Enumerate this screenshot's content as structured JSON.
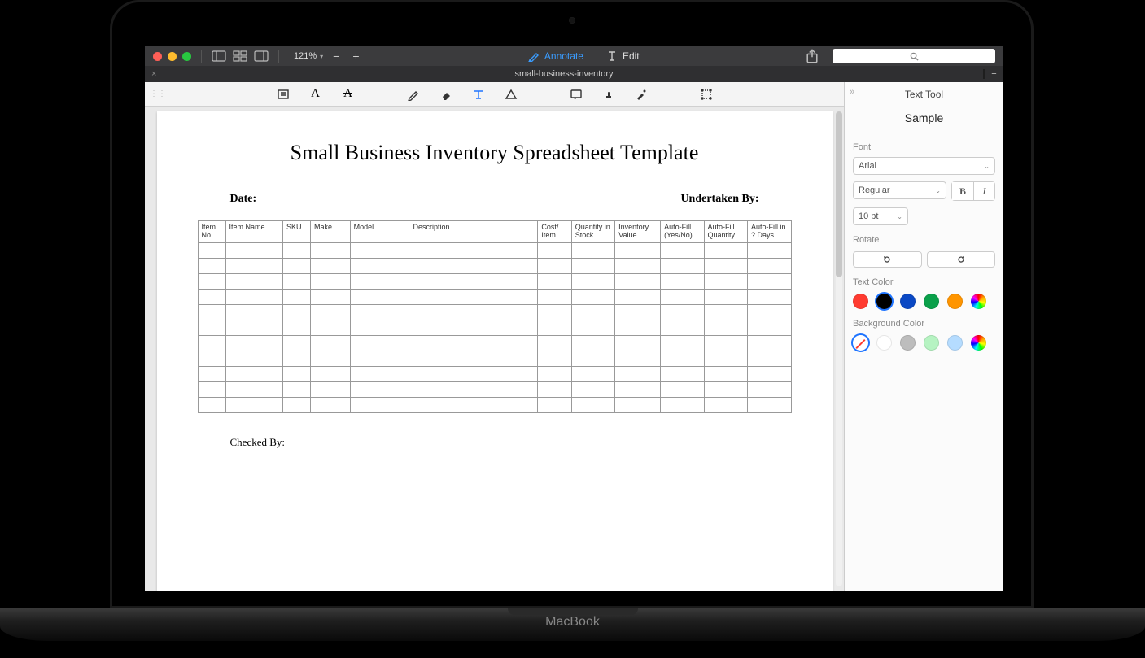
{
  "device": {
    "label": "MacBook"
  },
  "titlebar": {
    "zoom": "121%",
    "annotate": "Annotate",
    "edit": "Edit"
  },
  "tab": {
    "title": "small-business-inventory"
  },
  "document": {
    "title": "Small Business Inventory Spreadsheet Template",
    "date_label": "Date:",
    "undertaken_label": "Undertaken By:",
    "checked_label": "Checked By:",
    "columns": [
      "Item No.",
      "Item Name",
      "SKU",
      "Make",
      "Model",
      "Description",
      "Cost/ Item",
      "Quantity in Stock",
      "Inventory Value",
      "Auto-Fill (Yes/No)",
      "Auto-Fill Quantity",
      "Auto-Fill in ? Days"
    ],
    "empty_rows": 11
  },
  "sidebar": {
    "title": "Text Tool",
    "sample": "Sample",
    "labels": {
      "font": "Font",
      "rotate": "Rotate",
      "text_color": "Text Color",
      "bg_color": "Background Color"
    },
    "font_family": "Arial",
    "font_weight": "Regular",
    "font_size": "10 pt",
    "bold": "B",
    "italic": "I",
    "text_colors": [
      "#ff3b30",
      "#000000",
      "#0a48c4",
      "#0aa04a",
      "#ff9500"
    ],
    "text_color_selected": 1,
    "bg_colors_preset": [
      "#ffffff",
      "#bdbdbd",
      "#b6f3c2",
      "#b5dcff"
    ]
  }
}
